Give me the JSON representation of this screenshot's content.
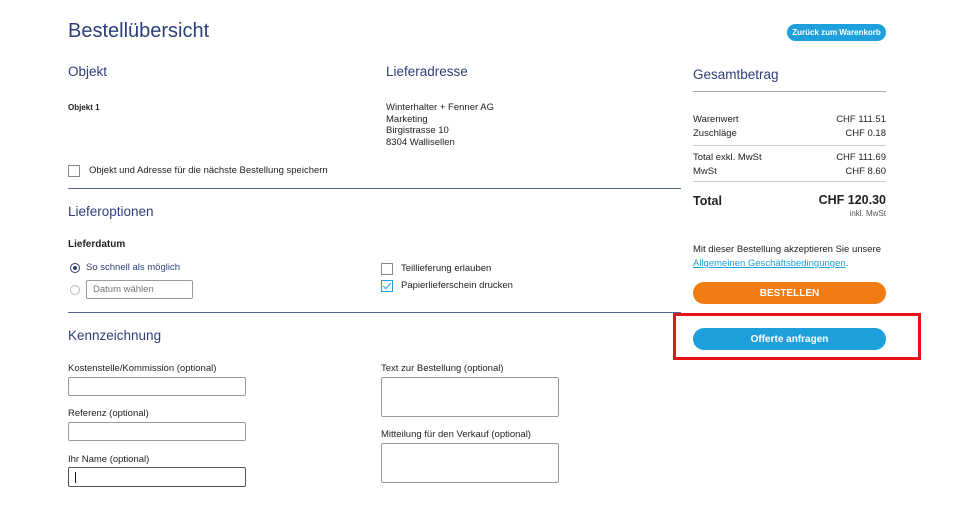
{
  "header": {
    "title": "Bestellübersicht",
    "back_button": "Zurück zum Warenkorb"
  },
  "objekt": {
    "heading": "Objekt",
    "value": "Objekt 1",
    "save_checkbox_label": "Objekt und Adresse für die nächste Bestellung speichern",
    "save_checked": false
  },
  "lieferadresse": {
    "heading": "Lieferadresse",
    "lines": [
      "Winterhalter + Fenner AG",
      "Marketing",
      "Birgistrasse 10",
      "8304 Wallisellen"
    ]
  },
  "lieferoptionen": {
    "heading": "Lieferoptionen",
    "lieferdatum_label": "Lieferdatum",
    "radio_asap": "So schnell als möglich",
    "radio_asap_selected": true,
    "date_placeholder": "Datum wählen",
    "teillieferung_label": "Teillieferung erlauben",
    "teillieferung_checked": false,
    "papierlieferschein_label": "Papierlieferschein drucken",
    "papierlieferschein_checked": true
  },
  "kennzeichnung": {
    "heading": "Kennzeichnung",
    "kostenstelle_label": "Kostenstelle/Kommission (optional)",
    "referenz_label": "Referenz (optional)",
    "name_label": "Ihr Name (optional)",
    "text_label": "Text zur Bestellung (optional)",
    "mitteilung_label": "Mitteilung für den Verkauf (optional)"
  },
  "summary": {
    "heading": "Gesamtbetrag",
    "rows1": [
      {
        "label": "Warenwert",
        "value": "CHF 111.51"
      },
      {
        "label": "Zuschläge",
        "value": "CHF 0.18"
      }
    ],
    "rows2": [
      {
        "label": "Total exkl. MwSt",
        "value": "CHF 111.69"
      },
      {
        "label": "MwSt",
        "value": "CHF 8.60"
      }
    ],
    "total_label": "Total",
    "total_value": "CHF 120.30",
    "total_note": "inkl. MwSt",
    "agb_text": "Mit dieser Bestellung akzeptieren Sie unsere",
    "agb_link": "Allgemeinen Geschäftsbedingungen",
    "agb_period": ".",
    "order_button": "BESTELLEN",
    "quote_button": "Offerte anfragen",
    "colors": {
      "brand": "#2d3e7a",
      "accent_blue": "#1ea0dc",
      "order_orange": "#f07c12",
      "highlight_red": "#e8141b"
    }
  }
}
